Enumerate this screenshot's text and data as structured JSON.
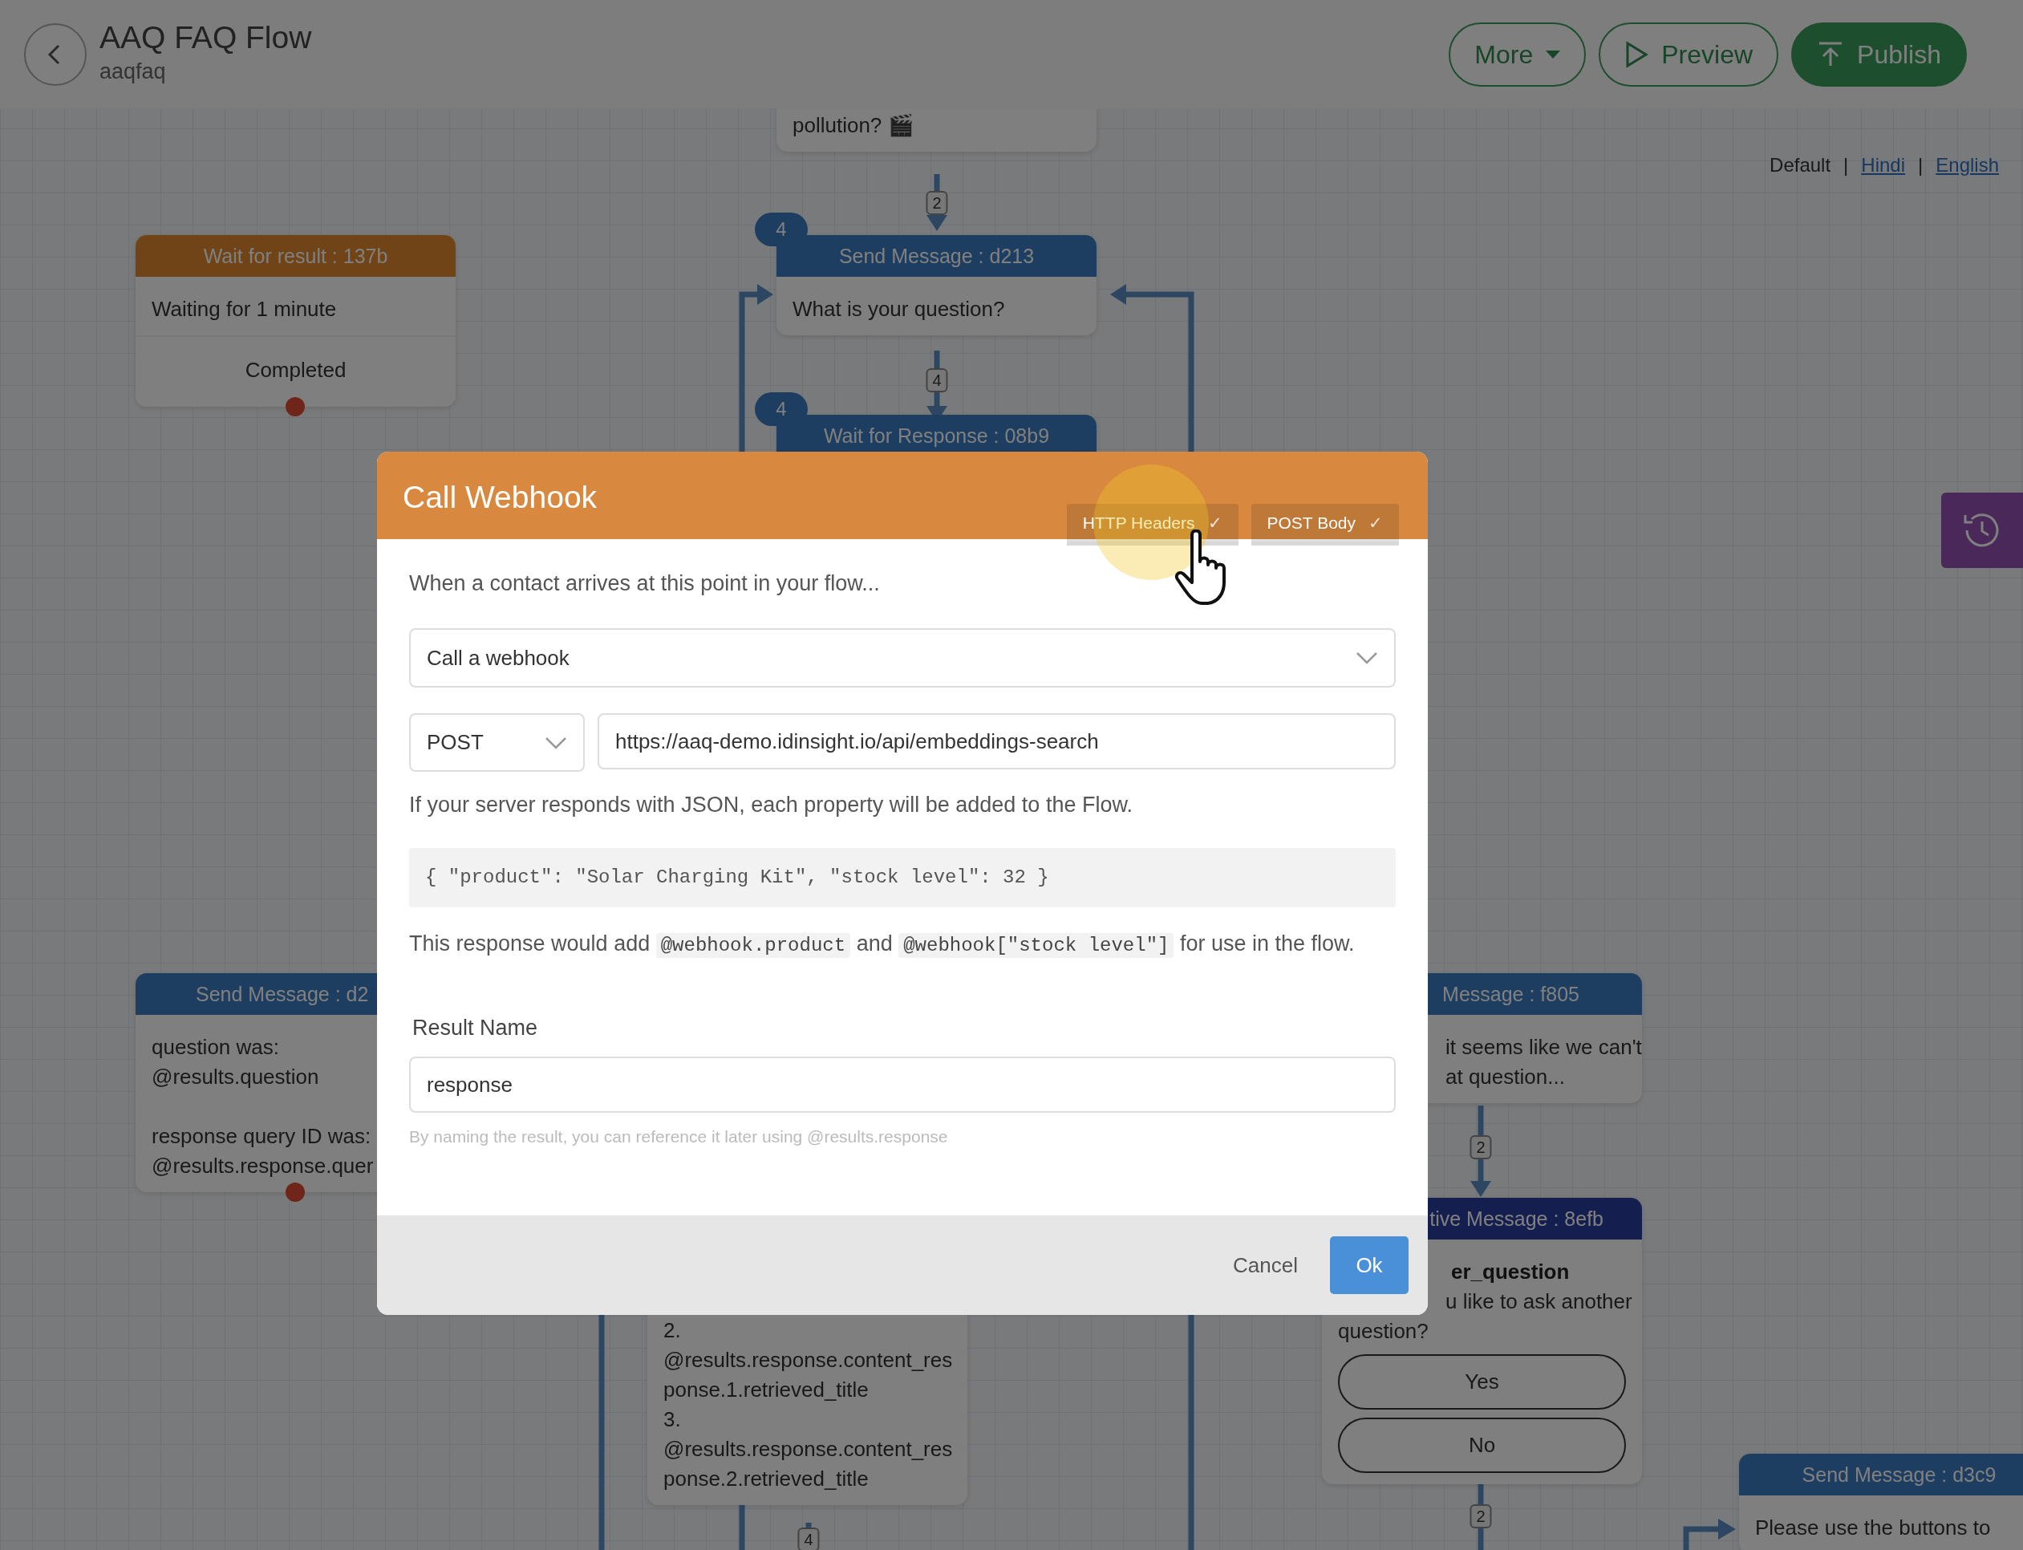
{
  "header": {
    "title": "AAQ FAQ Flow",
    "subtitle": "aaqfaq",
    "buttons": [
      {
        "label": "More",
        "kind": "dropdown"
      },
      {
        "label": "Preview",
        "kind": "preview"
      },
      {
        "label": "Publish",
        "kind": "publish"
      }
    ]
  },
  "languages": [
    {
      "label": "Default",
      "selected": true
    },
    {
      "label": "Hindi",
      "selected": false
    },
    {
      "label": "English",
      "selected": false
    }
  ],
  "language_separators": [
    "|",
    "|"
  ],
  "canvas": {
    "nodes": [
      {
        "kind": "message",
        "paragraphs": [
          [
            "pollution? 🎬"
          ]
        ]
      },
      {
        "kind": "wait",
        "title": "Wait for result : 137b",
        "paragraphs": [
          [
            "Waiting for 1 minute"
          ]
        ],
        "exits": [
          {
            "label": "Completed",
            "connected": false
          }
        ]
      },
      {
        "kind": "message",
        "title": "Send Message : d213",
        "badge": "4",
        "paragraphs": [
          [
            "What is your question?"
          ]
        ]
      },
      {
        "kind": "wait_response",
        "title": "Wait for Response : 08b9",
        "badge": "4"
      },
      {
        "kind": "message",
        "title": "Send Message : d2",
        "paragraphs": [
          [
            "question was:",
            "@results.question"
          ],
          [
            "response query ID was:",
            "@results.response.quer"
          ]
        ],
        "exits": [
          {
            "connected": false
          }
        ]
      },
      {
        "kind": "message",
        "paragraphs": [
          [
            "2.",
            "@results.response.content_res",
            "ponse.1.retrieved_title"
          ],
          [
            "3.",
            "@results.response.content_res",
            "ponse.2.retrieved_title"
          ]
        ]
      },
      {
        "kind": "message",
        "title": "Message : f805",
        "paragraphs": [
          [
            "it seems like we can't",
            "at question..."
          ]
        ]
      },
      {
        "kind": "interactive",
        "title": "tive Message : 8efb",
        "result": "er_question",
        "paragraphs": [
          [
            "u like to ask another",
            "question?"
          ]
        ],
        "buttons": [
          "Yes",
          "No"
        ]
      },
      {
        "kind": "message",
        "title": "Send Message : d3c9",
        "paragraphs": [
          [
            "Please use the buttons to"
          ]
        ]
      }
    ],
    "connector_labels": [
      "2",
      "4",
      "2",
      "2",
      "4"
    ]
  },
  "modal": {
    "title": "Call Webhook",
    "tabs": [
      {
        "label": "HTTP Headers",
        "checked": true
      },
      {
        "label": "POST Body",
        "checked": true
      }
    ],
    "check_mark": "✓",
    "intro": "When a contact arrives at this point in your flow...",
    "action": {
      "value": "Call a webhook"
    },
    "method": {
      "value": "POST"
    },
    "url": {
      "value": "https://aaq-demo.idinsight.io/api/embeddings-search"
    },
    "json_note": "If your server responds with JSON, each property will be added to the Flow.",
    "example": "{ \"product\": \"Solar Charging Kit\", \"stock level\": 32 }",
    "response_note": [
      {
        "kind": "text",
        "text": "This response would add "
      },
      {
        "kind": "code",
        "text": "@webhook.product"
      },
      {
        "kind": "text",
        "text": " and "
      },
      {
        "kind": "code",
        "text": "@webhook[\"stock level\"]"
      },
      {
        "kind": "text",
        "text": " for use in the flow."
      }
    ],
    "result_label": "Result Name",
    "result": {
      "value": "response"
    },
    "result_hint": "By naming the result, you can reference it later using @results.response",
    "buttons": [
      {
        "label": "Cancel",
        "kind": "secondary"
      },
      {
        "label": "Ok",
        "kind": "primary"
      }
    ]
  }
}
